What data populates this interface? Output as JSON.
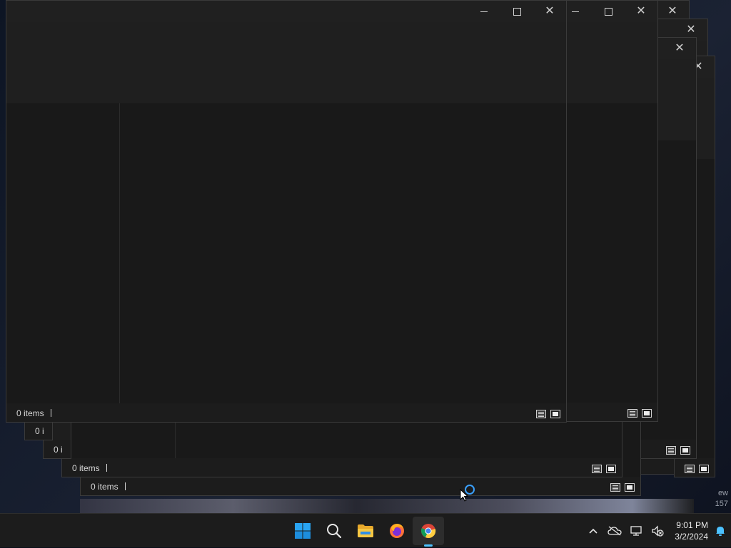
{
  "windows": [
    {
      "status": ""
    },
    {
      "status": ""
    },
    {
      "status": ""
    },
    {
      "status": ""
    },
    {
      "status": "0 i"
    },
    {
      "status": "0 i"
    },
    {
      "status": "0 items"
    },
    {
      "status": "0 items"
    },
    {
      "status": "0 items"
    }
  ],
  "desktop": {
    "text_line1": "ew",
    "text_line2": "157"
  },
  "taskbar": {
    "pinned": [
      {
        "name": "start-button",
        "icon": "windows-logo-icon"
      },
      {
        "name": "search-button",
        "icon": "search-icon"
      },
      {
        "name": "file-explorer-button",
        "icon": "folder-icon"
      },
      {
        "name": "firefox-button",
        "icon": "firefox-icon"
      },
      {
        "name": "chrome-button",
        "icon": "chrome-icon",
        "active": true
      }
    ],
    "time": "9:01 PM",
    "date": "3/2/2024"
  },
  "colors": {
    "accent": "#4cc2ff",
    "window_bg": "#1e1e1e",
    "taskbar_bg": "#1c1c1c"
  }
}
